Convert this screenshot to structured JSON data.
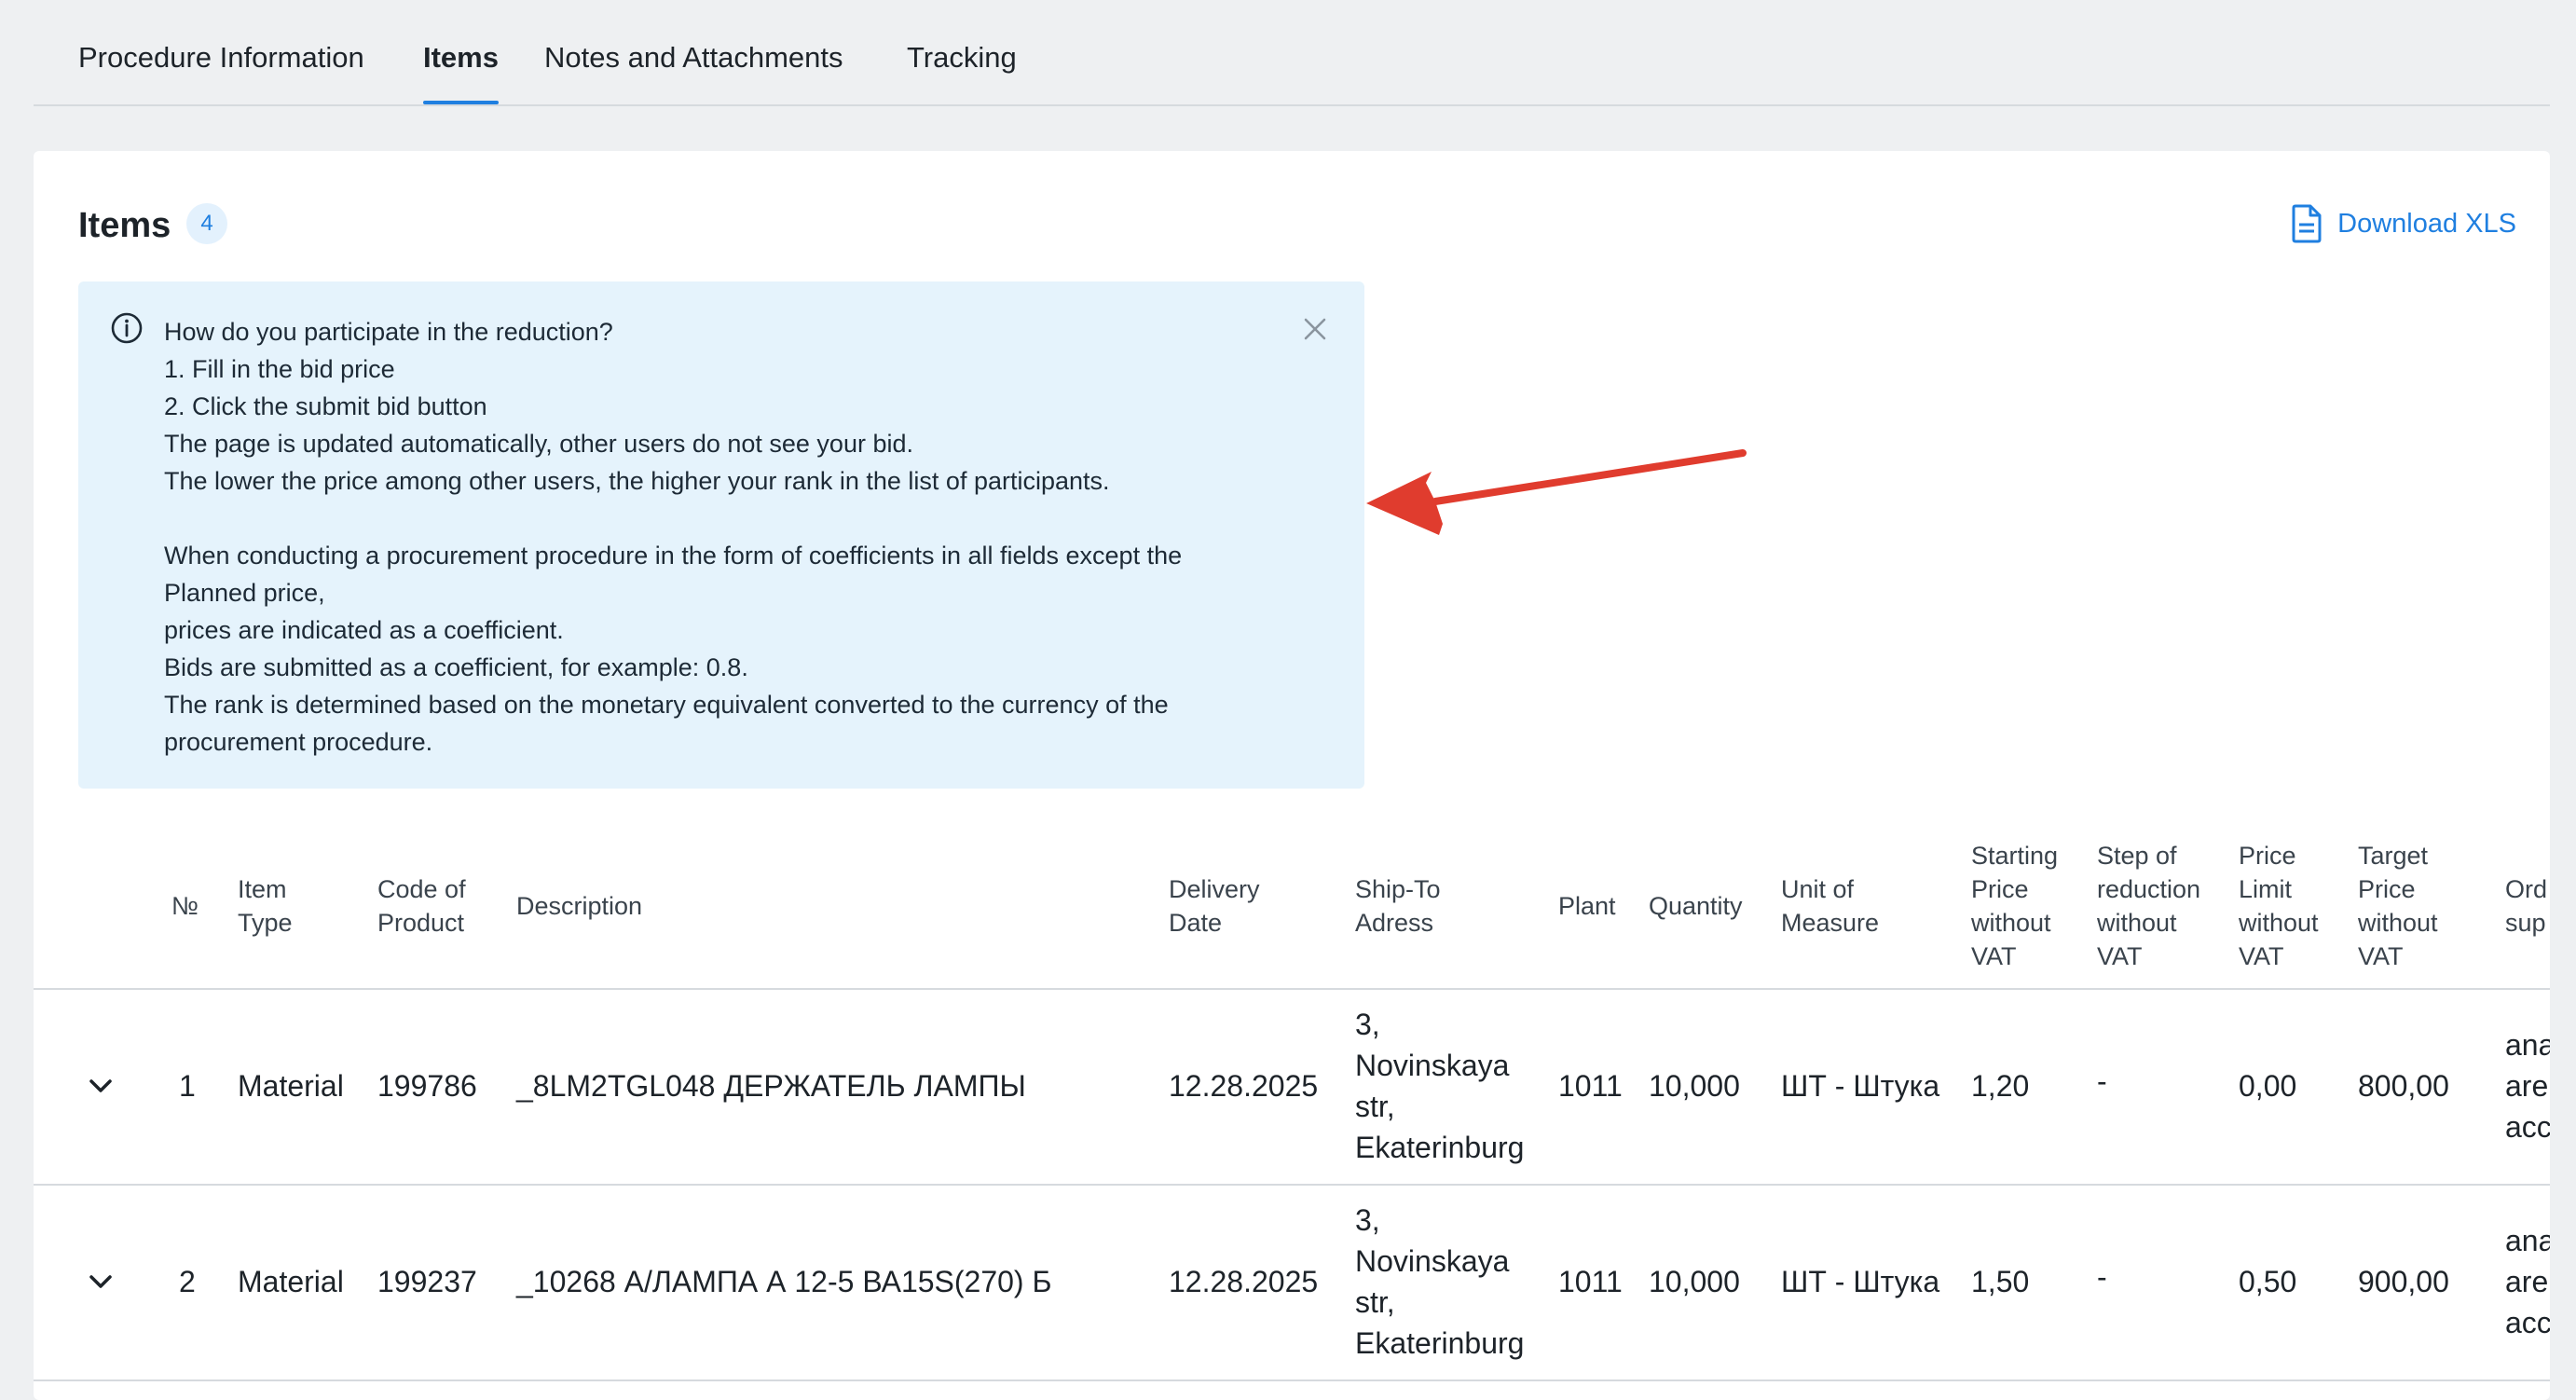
{
  "tabs": [
    {
      "label": "Procedure Information"
    },
    {
      "label": "Items"
    },
    {
      "label": "Notes and Attachments"
    },
    {
      "label": "Tracking"
    }
  ],
  "items_section": {
    "title": "Items",
    "count": "4",
    "download_label": "Download XLS"
  },
  "info": {
    "lines": [
      "How do you participate in the reduction?",
      "1. Fill in the bid price",
      "2. Click the submit bid button",
      "The page is updated automatically, other users do not see your bid.",
      "The lower the price among other users, the higher your rank in the list of participants.",
      "",
      "When conducting a procurement procedure in the form of coefficients in all fields except the",
      "Planned price,",
      "prices are indicated as a coefficient.",
      "Bids are submitted as a coefficient, for example: 0.8.",
      "The rank is determined based on the monetary equivalent converted to the currency of the",
      "procurement procedure."
    ]
  },
  "table": {
    "headers": {
      "no": "№",
      "item_type": "Item Type",
      "code": "Code of Product",
      "description": "Description",
      "delivery_date": "Delivery Date",
      "ship_to": "Ship-To Adress",
      "plant": "Plant",
      "quantity": "Quantity",
      "unit": "Unit of Measure",
      "starting_price": "Starting Price without VAT",
      "step": "Step of reduction without VAT",
      "price_limit": "Price Limit without VAT",
      "target_price": "Target Price without VAT",
      "ord": "Ord sup"
    },
    "rows": [
      {
        "no": "1",
        "item_type": "Material",
        "code": "199786",
        "description": "_8LM2TGL048 ДЕРЖАТЕЛЬ ЛАМПЫ",
        "delivery_date": "12.28.2025",
        "ship_to": "3, Novinskaya str, Ekaterinburg",
        "plant": "1011",
        "quantity": "10,000",
        "unit": "ШТ - Штука",
        "starting_price": "1,20",
        "step": "-",
        "price_limit": "0,00",
        "target_price": "800,00",
        "ord": "ana are acc"
      },
      {
        "no": "2",
        "item_type": "Material",
        "code": "199237",
        "description": "_10268 А/ЛАМПА А 12-5 ВА15S(270) Б",
        "delivery_date": "12.28.2025",
        "ship_to": "3, Novinskaya str, Ekaterinburg",
        "plant": "1011",
        "quantity": "10,000",
        "unit": "ШТ - Штука",
        "starting_price": "1,50",
        "step": "-",
        "price_limit": "0,50",
        "target_price": "900,00",
        "ord": "ana are acc"
      }
    ]
  },
  "colors": {
    "accent": "#1f7fe0",
    "info_bg": "#e5f3fc",
    "arrow": "#e03c2e"
  }
}
